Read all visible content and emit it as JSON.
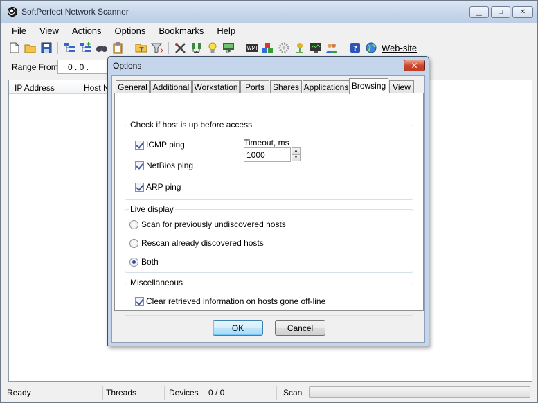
{
  "window": {
    "title": "SoftPerfect Network Scanner",
    "minimize": "▁",
    "maximize": "□",
    "close": "✕"
  },
  "menu": [
    "File",
    "View",
    "Actions",
    "Options",
    "Bookmarks",
    "Help"
  ],
  "toolbar": {
    "website_label": "Web-site"
  },
  "range": {
    "label": "Range From",
    "value": "0   .   0   ."
  },
  "results": {
    "columns": [
      "IP Address",
      "Host Na"
    ]
  },
  "status": {
    "ready": "Ready",
    "threads": "Threads",
    "devices_label": "Devices",
    "devices_value": "0 / 0",
    "scan": "Scan"
  },
  "dialog": {
    "title": "Options",
    "close": "✕",
    "tabs": [
      "General",
      "Additional",
      "Workstation",
      "Ports",
      "Shares",
      "Applications",
      "Browsing",
      "View"
    ],
    "active_tab": "Browsing",
    "check_group": {
      "legend": "Check if host is up before access",
      "icmp": "ICMP ping",
      "netbios": "NetBios ping",
      "arp": "ARP ping",
      "timeout_label": "Timeout, ms",
      "timeout_value": "1000"
    },
    "live_group": {
      "legend": "Live display",
      "opt1": "Scan for previously undiscovered hosts",
      "opt2": "Rescan already discovered hosts",
      "opt3": "Both"
    },
    "misc_group": {
      "legend": "Miscellaneous",
      "clear": "Clear retrieved information on hosts gone off-line"
    },
    "ok": "OK",
    "cancel": "Cancel"
  }
}
